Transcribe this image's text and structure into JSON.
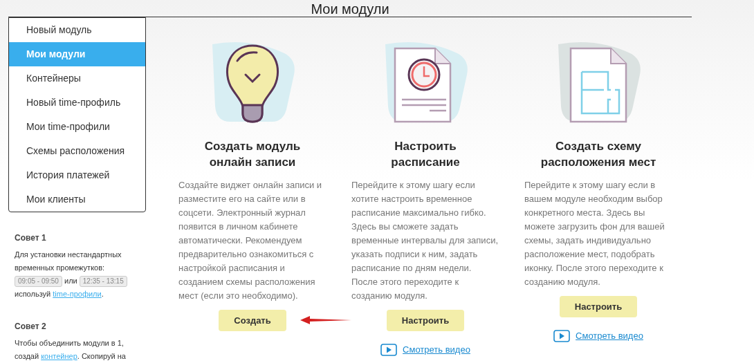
{
  "page_title": "Мои модули",
  "sidebar": {
    "items": [
      {
        "label": "Новый модуль",
        "selected": false
      },
      {
        "label": "Мои модули",
        "selected": true
      },
      {
        "label": "Контейнеры",
        "selected": false
      },
      {
        "label": "Новый time-профиль",
        "selected": false
      },
      {
        "label": "Мои time-профили",
        "selected": false
      },
      {
        "label": "Схемы расположения",
        "selected": false
      },
      {
        "label": "История платежей",
        "selected": false
      },
      {
        "label": "Мои клиенты",
        "selected": false
      }
    ]
  },
  "tips": [
    {
      "title": "Совет 1",
      "parts": [
        {
          "kind": "text",
          "text": "Для установки нестандартных временных промежутков:"
        },
        {
          "kind": "chip",
          "text": "09:05 - 09:50"
        },
        {
          "kind": "text",
          "text": "или"
        },
        {
          "kind": "chip",
          "text": "12:35 - 13:15"
        },
        {
          "kind": "text",
          "text": "используй"
        },
        {
          "kind": "link",
          "text": "time-профили"
        },
        {
          "kind": "text",
          "text": "."
        }
      ]
    },
    {
      "title": "Совет 2",
      "parts": [
        {
          "kind": "text",
          "text": "Чтобы объединить модули в 1, создай"
        },
        {
          "kind": "link",
          "text": "контейнер"
        },
        {
          "kind": "text",
          "text": ". Скопируй на"
        }
      ]
    }
  ],
  "cards": [
    {
      "kind": "bulb",
      "title": "Создать модуль онлайн записи",
      "description": "Создайте виджет онлайн записи и разместите его на сайте или в соцсети. Электронный журнал появится в личном кабинете автоматически. Рекомендуем предварительно ознакомиться с настройкой расписания и созданием схемы расположения мест (если это необходимо).",
      "button": "Создать",
      "arrow": true
    },
    {
      "kind": "schedule",
      "title": "Настроить расписание",
      "description": "Перейдите к этому шагу если хотите настроить временное расписание максимально гибко. Здесь вы сможете задать временные интервалы для записи, указать подписи к ним, задать расписание по дням недели. После этого переходите к созданию модуля.",
      "button": "Настроить",
      "arrow": false,
      "video_link": "Смотреть видео"
    },
    {
      "kind": "plan",
      "title": "Создать схему расположения мест",
      "description": "Перейдите к этому шагу если в вашем модуле необходим выбор конкретного места. Здесь вы можете загрузить фон для вашей схемы, задать индивидуально расположение мест, подобрать иконку. После этого переходите к созданию модуля.",
      "button": "Настроить",
      "arrow": false,
      "video_link": "Смотреть видео"
    }
  ]
}
